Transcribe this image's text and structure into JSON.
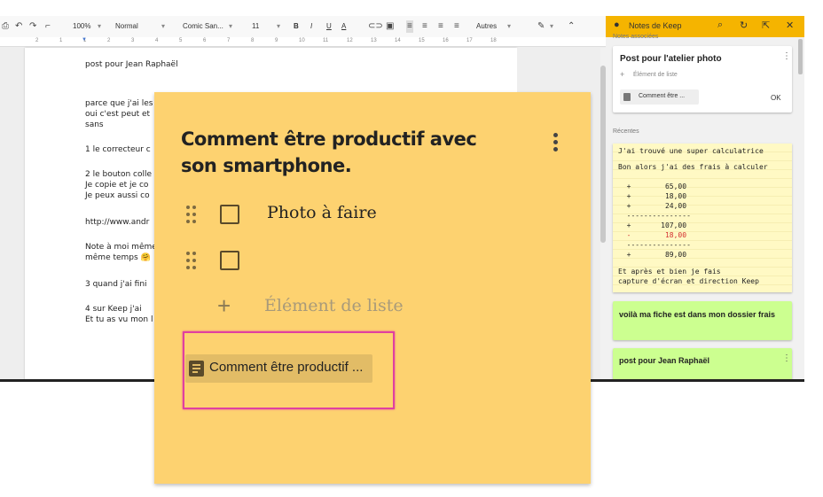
{
  "toolbar": {
    "zoom": "100%",
    "style": "Normal",
    "font": "Comic San...",
    "size": "11",
    "bold": "B",
    "italic": "I",
    "underline": "U",
    "text_color": "A",
    "more": "Autres"
  },
  "ruler": {
    "ticks": [
      "2",
      "1",
      "1",
      "2",
      "3",
      "4",
      "5",
      "6",
      "7",
      "8",
      "9",
      "10",
      "11",
      "12",
      "13",
      "14",
      "15",
      "16",
      "17",
      "18"
    ]
  },
  "doc": {
    "lines": [
      "post pour Jean Raphaël",
      "parce que j'ai les",
      "oui c'est peut et",
      "sans",
      "1  le correcteur c",
      "2 le bouton colle",
      "Je copie et je co",
      "Je peux aussi co",
      "http://www.andr",
      "Note à moi même",
      "même temps 🤗",
      "3 quand  j'ai fini",
      "  4 sur Keep j'ai",
      "Et tu as vu mon l"
    ]
  },
  "keep_panel": {
    "title": "Notes de Keep",
    "associated_label": "Notes associées",
    "card1": {
      "title": "Post pour l'atelier photo",
      "add_item": "Élément de liste",
      "chip": "Comment être ...",
      "ok": "OK"
    },
    "recent_label": "Récentes",
    "calc_lines": [
      "J'ai trouvé une super calculatrice",
      "Bon alors j'ai des frais à calculer",
      "  +        65,00",
      "  +        18,00",
      "  +        24,00",
      "  ---------------",
      "  +       107,00",
      "  -        18,00",
      "  ---------------",
      "  +        89,00",
      "Et après et bien je fais",
      "capture d'écran et direction Keep"
    ],
    "green_card1": "voilà ma fiche est dans mon dossier frais",
    "green_card2": "post pour Jean Raphaël"
  },
  "note": {
    "title": "Comment être productif avec son smartphone.",
    "item1": "Photo à  faire",
    "item2": "",
    "add_item": "Élément de liste",
    "chip": "Comment être productif ...",
    "color": "#fdd270",
    "highlight_color": "#e040a0"
  }
}
